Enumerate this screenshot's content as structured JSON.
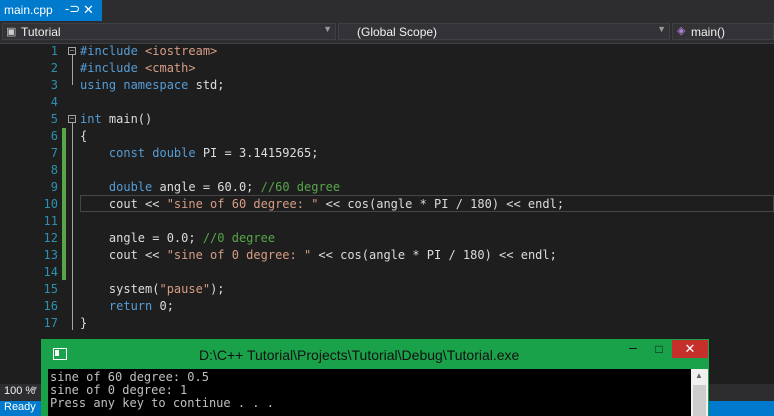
{
  "tab": {
    "title": "main.cpp",
    "pin": "-⊃",
    "close": "✕"
  },
  "nav": {
    "project": "Tutorial",
    "scope": "(Global Scope)",
    "member": "main()"
  },
  "code_lines": [
    {
      "n": "1",
      "parts": [
        {
          "t": "#include ",
          "c": "kw"
        },
        {
          "t": "<iostream>",
          "c": "str"
        }
      ]
    },
    {
      "n": "2",
      "parts": [
        {
          "t": "#include ",
          "c": "kw"
        },
        {
          "t": "<cmath>",
          "c": "str"
        }
      ]
    },
    {
      "n": "3",
      "parts": [
        {
          "t": "using namespace ",
          "c": "kw"
        },
        {
          "t": "std;",
          "c": ""
        }
      ]
    },
    {
      "n": "4",
      "parts": []
    },
    {
      "n": "5",
      "parts": [
        {
          "t": "int ",
          "c": "kw"
        },
        {
          "t": "main()",
          "c": ""
        }
      ]
    },
    {
      "n": "6",
      "parts": [
        {
          "t": "{",
          "c": ""
        }
      ]
    },
    {
      "n": "7",
      "parts": [
        {
          "t": "    ",
          "c": ""
        },
        {
          "t": "const double ",
          "c": "kw"
        },
        {
          "t": "PI = 3.14159265;",
          "c": ""
        }
      ]
    },
    {
      "n": "8",
      "parts": []
    },
    {
      "n": "9",
      "parts": [
        {
          "t": "    ",
          "c": ""
        },
        {
          "t": "double ",
          "c": "kw"
        },
        {
          "t": "angle = 60.0; ",
          "c": ""
        },
        {
          "t": "//60 degree",
          "c": "cm"
        }
      ]
    },
    {
      "n": "10",
      "parts": [
        {
          "t": "    cout << ",
          "c": ""
        },
        {
          "t": "\"sine of 60 degree: \"",
          "c": "str"
        },
        {
          "t": " << cos(angle * PI / 180) << endl;",
          "c": ""
        }
      ]
    },
    {
      "n": "11",
      "parts": []
    },
    {
      "n": "12",
      "parts": [
        {
          "t": "    angle = 0.0; ",
          "c": ""
        },
        {
          "t": "//0 degree",
          "c": "cm"
        }
      ]
    },
    {
      "n": "13",
      "parts": [
        {
          "t": "    cout << ",
          "c": ""
        },
        {
          "t": "\"sine of 0 degree: \"",
          "c": "str"
        },
        {
          "t": " << cos(angle * PI / 180) << endl;",
          "c": ""
        }
      ]
    },
    {
      "n": "14",
      "parts": []
    },
    {
      "n": "15",
      "parts": [
        {
          "t": "    system(",
          "c": ""
        },
        {
          "t": "\"pause\"",
          "c": "str"
        },
        {
          "t": ");",
          "c": ""
        }
      ]
    },
    {
      "n": "16",
      "parts": [
        {
          "t": "    ",
          "c": ""
        },
        {
          "t": "return ",
          "c": "kw"
        },
        {
          "t": "0;",
          "c": ""
        }
      ]
    },
    {
      "n": "17",
      "parts": [
        {
          "t": "}",
          "c": ""
        }
      ]
    }
  ],
  "zoom": "100 %",
  "console": {
    "title": "D:\\C++ Tutorial\\Projects\\Tutorial\\Debug\\Tutorial.exe",
    "lines": [
      "sine of 60 degree: 0.5",
      "sine of 0 degree: 1",
      "Press any key to continue . . ."
    ],
    "minimize": "–",
    "maximize": "□",
    "close": "✕"
  },
  "status": {
    "text": "Ready"
  },
  "colors": {
    "accent": "#007acc",
    "console_titlebar": "#1aa24a",
    "close_button": "#c7302a"
  }
}
